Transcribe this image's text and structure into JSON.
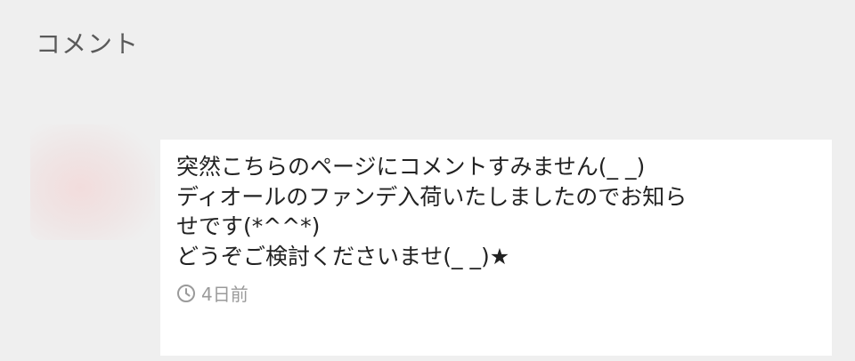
{
  "header": {
    "title": "コメント"
  },
  "comment": {
    "text": "突然こちらのページにコメントすみません(_ _)\nディオールのファンデ入荷いたしましたのでお知ら\nせです(*^^*)\nどうぞご検討くださいませ(_ _)★",
    "time": "4日前",
    "time_icon": "clock-icon"
  }
}
